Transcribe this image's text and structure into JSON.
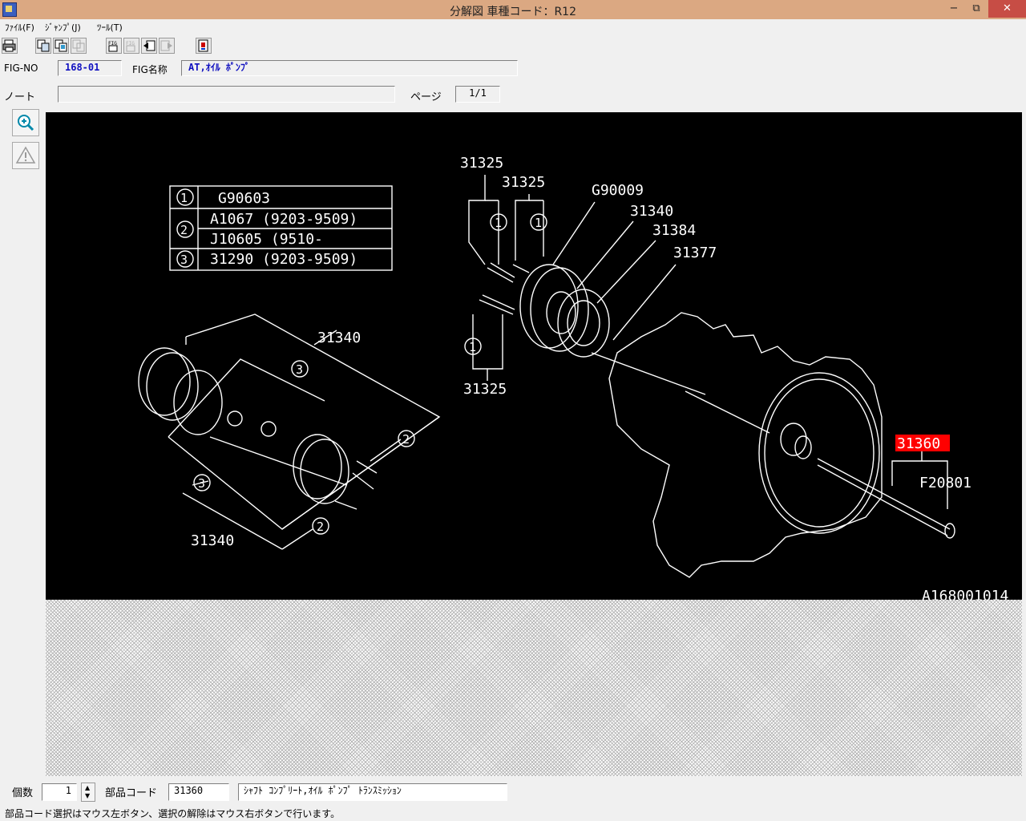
{
  "window": {
    "title": "分解図 車種コード：R12",
    "minimize": "−",
    "restore": "⧉",
    "close": "✕"
  },
  "menu": {
    "file": "ﾌｧｲﾙ(F)",
    "jump": "ｼﾞｬﾝﾌﾟ(J)",
    "tool": "ﾂｰﾙ(T)"
  },
  "header": {
    "fig_no_label": "FIG-NO",
    "fig_no_value": "168-01",
    "fig_name_label": "FIG名称",
    "fig_name_value": "AT,ｵｲﾙ ﾎﾟﾝﾌﾟ",
    "note_label": "ノート",
    "note_value": "",
    "page_label": "ページ",
    "page_value": "1/1"
  },
  "diagram": {
    "legend_rows": [
      {
        "num": "1",
        "text": "G90603"
      },
      {
        "num": "2",
        "text": "A1067 (9203-9509)"
      },
      {
        "num": "",
        "text": "J10605 (9510-"
      },
      {
        "num": "3",
        "text": "31290 (9203-9509)"
      }
    ],
    "labels": {
      "p31325a": "31325",
      "p31325b": "31325",
      "p31325c": "31325",
      "g90009": "G90009",
      "p31340a": "31340",
      "p31384": "31384",
      "p31377": "31377",
      "p31340b": "31340",
      "p31340c": "31340",
      "p31360": "31360",
      "f20801": "F20801",
      "code": "A168001014"
    },
    "circle_nums": {
      "c1a": "1",
      "c1b": "1",
      "c1c": "1",
      "c3a": "3",
      "c3b": "3",
      "c2a": "2",
      "c2b": "2"
    },
    "highlight_color": "#ff0000"
  },
  "bottom": {
    "qty_label": "個数",
    "qty_value": "1",
    "part_code_label": "部品コード",
    "part_code_value": "31360",
    "part_name_value": "ｼｬﾌﾄ ｺﾝﾌﾟﾘｰﾄ,ｵｲﾙ ﾎﾟﾝﾌﾟ ﾄﾗﾝｽﾐｯｼｮﾝ"
  },
  "status": {
    "message": "部品コード選択はマウス左ボタン、選択の解除はマウス右ボタンで行います。"
  },
  "icons": [
    "print-icon",
    "copy-icon",
    "copy-multi-icon",
    "copy-disabled-icon",
    "fig-first-icon",
    "fig-prev-icon",
    "fig-back-icon",
    "fig-forward-icon",
    "exit-icon",
    "zoom-in-icon",
    "warning-icon"
  ]
}
